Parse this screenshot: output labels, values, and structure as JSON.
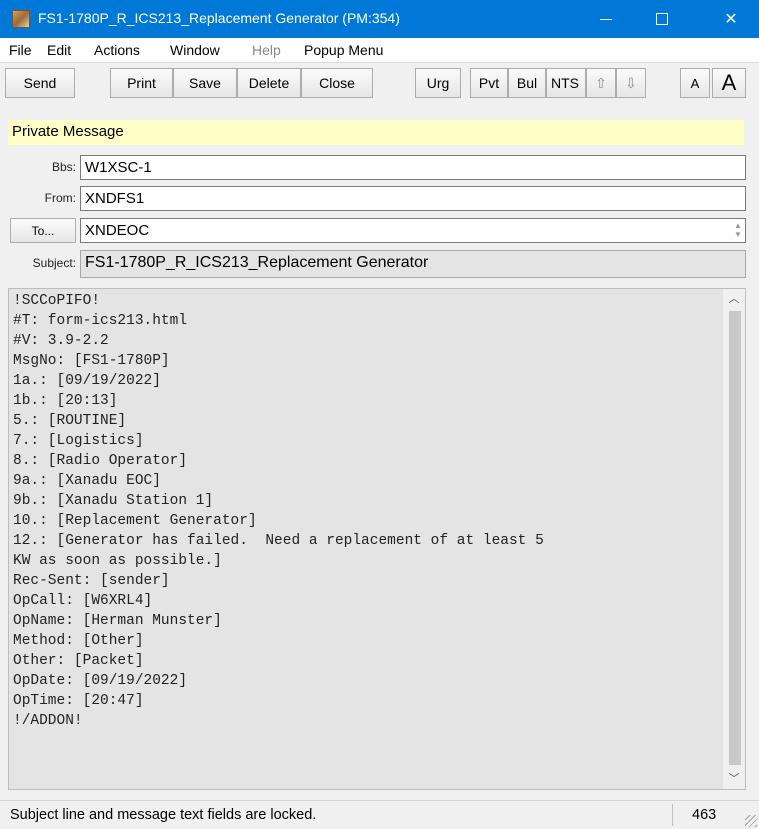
{
  "window": {
    "title": "FS1-1780P_R_ICS213_Replacement Generator  (PM:354)",
    "app_icon": "packet-app-icon",
    "accent_color": "#0078d7"
  },
  "menu": {
    "items": [
      {
        "label": "File",
        "enabled": true
      },
      {
        "label": "Edit",
        "enabled": true
      },
      {
        "label": "Actions",
        "enabled": true
      },
      {
        "label": "Window",
        "enabled": true
      },
      {
        "label": "Help",
        "enabled": false
      },
      {
        "label": "Popup Menu",
        "enabled": true
      }
    ]
  },
  "toolbar": {
    "send": "Send",
    "print": "Print",
    "save": "Save",
    "delete": "Delete",
    "close": "Close",
    "urg": "Urg",
    "pvt": "Pvt",
    "bul": "Bul",
    "nts": "NTS",
    "font_small": "A",
    "font_large": "A"
  },
  "banner": {
    "text": "Private Message",
    "color": "#ffffc8"
  },
  "fields": {
    "bbs_label": "Bbs:",
    "bbs_value": "W1XSC-1",
    "from_label": "From:",
    "from_value": "XNDFS1",
    "to_button": "To...",
    "to_value": "XNDEOC",
    "subject_label": "Subject:",
    "subject_value": "FS1-1780P_R_ICS213_Replacement Generator"
  },
  "message": {
    "lines": [
      "!SCCoPIFO!",
      "#T: form-ics213.html",
      "#V: 3.9-2.2",
      "MsgNo: [FS1-1780P]",
      "1a.: [09/19/2022]",
      "1b.: [20:13]",
      "5.: [ROUTINE]",
      "7.: [Logistics]",
      "8.: [Radio Operator]",
      "9a.: [Xanadu EOC]",
      "9b.: [Xanadu Station 1]",
      "10.: [Replacement Generator]",
      "12.: [Generator has failed.  Need a replacement of at least 5",
      "KW as soon as possible.]",
      "Rec-Sent: [sender]",
      "OpCall: [W6XRL4]",
      "OpName: [Herman Munster]",
      "Method: [Other]",
      "Other: [Packet]",
      "OpDate: [09/19/2022]",
      "OpTime: [20:47]",
      "!/ADDON!"
    ]
  },
  "status": {
    "text": "Subject line and message text fields are locked.",
    "count": "463"
  }
}
